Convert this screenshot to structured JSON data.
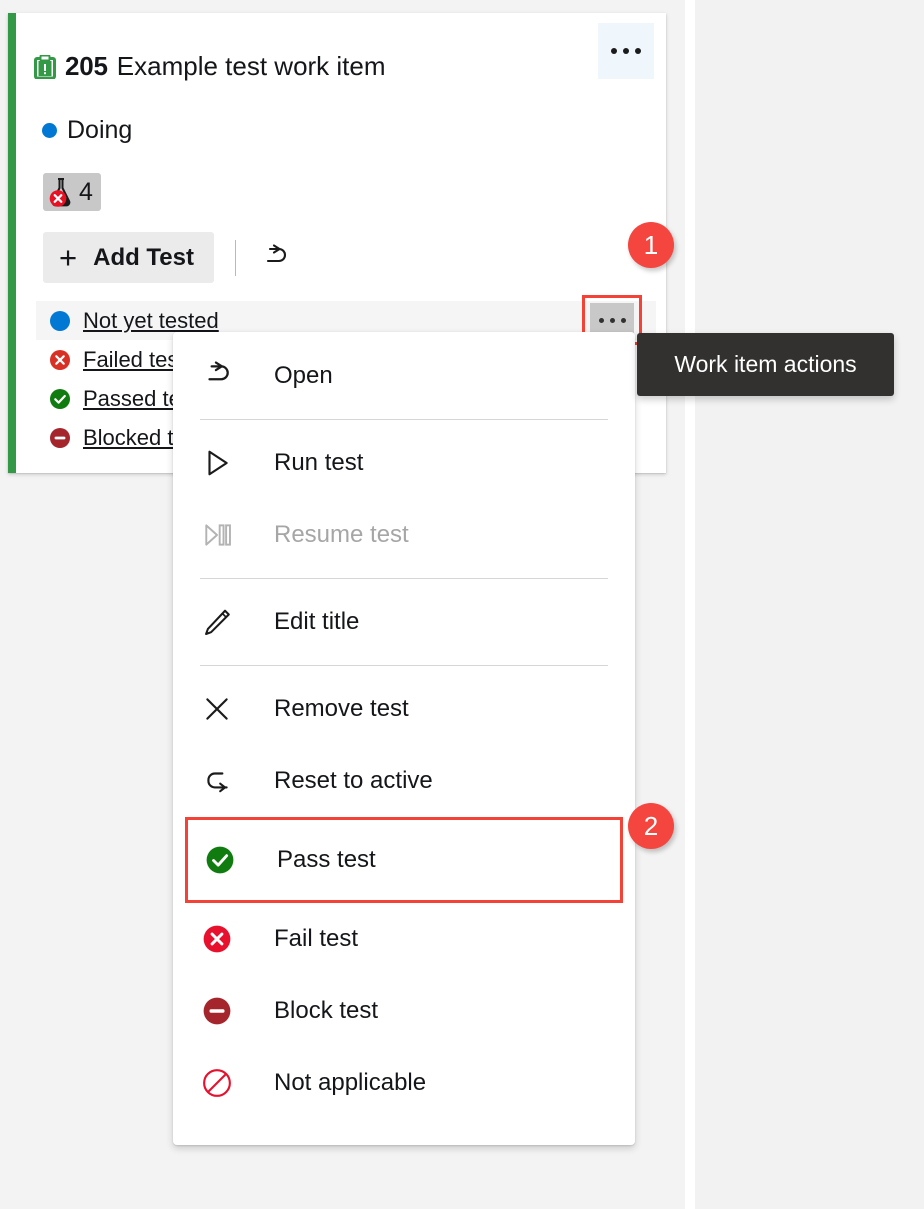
{
  "card": {
    "work_item_icon": "task-clipboard-icon",
    "accent_color": "#339947",
    "id": "205",
    "title": "Example test work item",
    "state": "Doing",
    "state_color": "#0078d4",
    "test_count_chip": {
      "icon": "failed-beaker-icon",
      "count": "4"
    },
    "more_button_icon": "ellipsis-icon"
  },
  "toolbar": {
    "add_test_label": "Add Test",
    "add_test_icon": "plus-icon",
    "open_icon": "open-arrow-icon"
  },
  "test_list": [
    {
      "label": "Not yet tested",
      "icon": "active-blue-circle-icon",
      "color": "#0078d4",
      "selected": true
    },
    {
      "label": "Failed tes",
      "icon": "failed-x-circle-icon",
      "color": "#d13438",
      "selected": false
    },
    {
      "label": "Passed te",
      "icon": "passed-check-circle-icon",
      "color": "#107c10",
      "selected": false
    },
    {
      "label": "Blocked t",
      "icon": "blocked-minus-circle-icon",
      "color": "#a4262c",
      "selected": false
    }
  ],
  "context_menu": [
    {
      "label": "Open",
      "icon": "open-arrow-icon",
      "disabled": false,
      "highlighted": false,
      "sep_after": true
    },
    {
      "label": "Run test",
      "icon": "play-triangle-icon",
      "disabled": false,
      "highlighted": false,
      "sep_after": false
    },
    {
      "label": "Resume test",
      "icon": "resume-play-icon",
      "disabled": true,
      "highlighted": false,
      "sep_after": true
    },
    {
      "label": "Edit title",
      "icon": "pencil-icon",
      "disabled": false,
      "highlighted": false,
      "sep_after": true
    },
    {
      "label": "Remove test",
      "icon": "close-x-icon",
      "disabled": false,
      "highlighted": false,
      "sep_after": false
    },
    {
      "label": "Reset to active",
      "icon": "undo-arrow-icon",
      "disabled": false,
      "highlighted": false,
      "sep_after": false
    },
    {
      "label": "Pass test",
      "icon": "passed-check-circle-icon",
      "disabled": false,
      "highlighted": true,
      "sep_after": false
    },
    {
      "label": "Fail test",
      "icon": "failed-x-circle-icon",
      "disabled": false,
      "highlighted": false,
      "sep_after": false
    },
    {
      "label": "Block test",
      "icon": "blocked-minus-circle-icon",
      "disabled": false,
      "highlighted": false,
      "sep_after": false
    },
    {
      "label": "Not applicable",
      "icon": "not-applicable-icon",
      "disabled": false,
      "highlighted": false,
      "sep_after": false
    }
  ],
  "tooltip": {
    "text": "Work item actions"
  },
  "annotations": [
    {
      "number": "1"
    },
    {
      "number": "2"
    }
  ],
  "colors": {
    "accent_green": "#339947",
    "blue": "#0078d4",
    "red": "#d13438",
    "dark_red": "#a4262c",
    "green": "#107c10",
    "annotation_red": "#f4453f",
    "highlight_red": "#f44336",
    "tooltip_bg": "#323130"
  }
}
